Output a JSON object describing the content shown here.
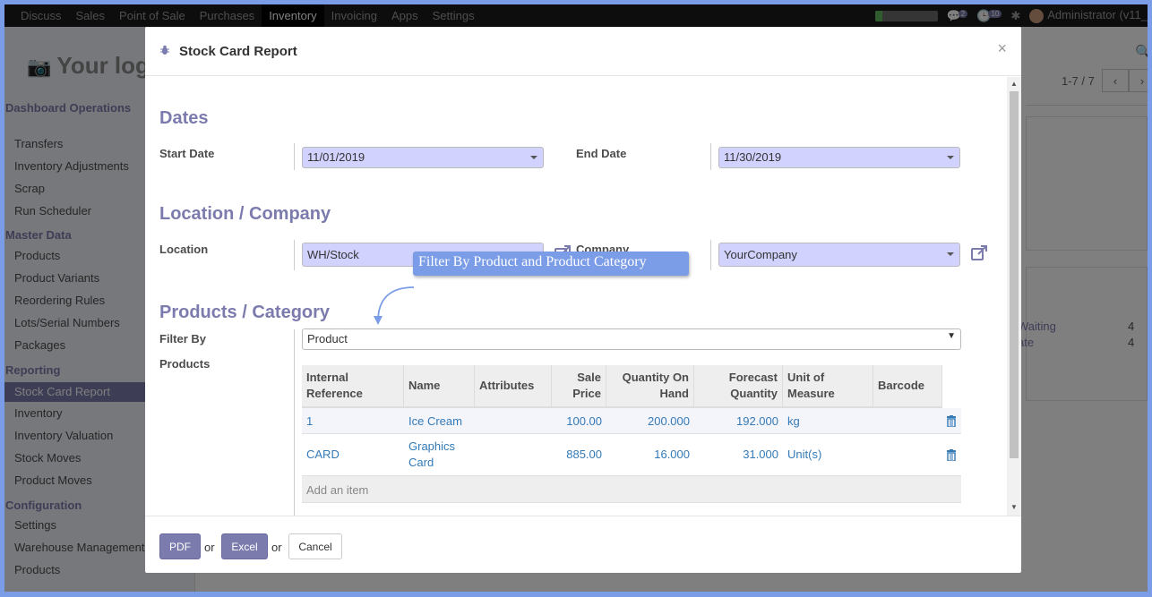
{
  "topbar": {
    "menu": [
      "Discuss",
      "Sales",
      "Point of Sale",
      "Purchases",
      "Inventory",
      "Invoicing",
      "Apps",
      "Settings"
    ],
    "active": "Inventory",
    "messages_count": "2",
    "activities_count": "10",
    "user": "Administrator (v11_"
  },
  "sidebar": {
    "logo": "Your log",
    "sections": [
      {
        "title": "Dashboard Operations",
        "items": [
          "Transfers",
          "Inventory Adjustments",
          "Scrap",
          "Run Scheduler"
        ]
      },
      {
        "title": "Master Data",
        "items": [
          "Products",
          "Product Variants",
          "Reordering Rules",
          "Lots/Serial Numbers",
          "Packages"
        ]
      },
      {
        "title": "Reporting",
        "items": [
          "Stock Card Report",
          "Inventory",
          "Inventory Valuation",
          "Stock Moves",
          "Product Moves"
        ]
      },
      {
        "title": "Configuration",
        "items": [
          "Settings",
          "Warehouse Management",
          "Products"
        ]
      }
    ],
    "active_item": "Stock Card Report"
  },
  "background": {
    "pager": "1-7 / 7",
    "waiting_label": "Waiting",
    "waiting_count": "4",
    "late_label": "ate",
    "late_count": "4"
  },
  "modal": {
    "title": "Stock Card Report",
    "dates_heading": "Dates",
    "start_date_label": "Start Date",
    "start_date_value": "11/01/2019",
    "end_date_label": "End Date",
    "end_date_value": "11/30/2019",
    "location_heading": "Location / Company",
    "location_label": "Location",
    "location_value": "WH/Stock",
    "company_label": "Company",
    "company_value": "YourCompany",
    "products_heading": "Products / Category",
    "filter_by_label": "Filter By",
    "filter_by_value": "Product",
    "products_label": "Products",
    "tooltip": "Filter By Product and Product Category",
    "table": {
      "columns": [
        "Internal Reference",
        "Name",
        "Attributes",
        "Sale Price",
        "Quantity On Hand",
        "Forecast Quantity",
        "Unit of Measure",
        "Barcode"
      ],
      "rows": [
        {
          "ref": "1",
          "name": "Ice Cream",
          "attributes": "",
          "price": "100.00",
          "qty": "200.000",
          "forecast": "192.000",
          "uom": "kg",
          "barcode": ""
        },
        {
          "ref": "CARD",
          "name": "Graphics Card",
          "attributes": "",
          "price": "885.00",
          "qty": "16.000",
          "forecast": "31.000",
          "uom": "Unit(s)",
          "barcode": ""
        }
      ],
      "add_item": "Add an item"
    },
    "buttons": {
      "pdf": "PDF",
      "or1": "or",
      "excel": "Excel",
      "or2": "or",
      "cancel": "Cancel"
    }
  },
  "colors": {
    "accent": "#7c7bad",
    "frame": "#7b9ce6",
    "select_bg": "#d2d2ff",
    "link": "#337ab7"
  }
}
